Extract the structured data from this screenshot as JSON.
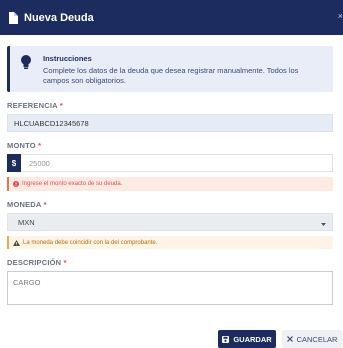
{
  "modal": {
    "title": "Nueva Deuda",
    "close_label": "×"
  },
  "info": {
    "title": "Instrucciones",
    "text": "Complete los datos de la deuda que desea registrar manualmente. Todos los campos son obligatorios."
  },
  "fields": {
    "referencia": {
      "label": "REFERENCIA",
      "required": "*",
      "value": "HLCUABCD12345678"
    },
    "monto": {
      "label": "MONTO",
      "required": "*",
      "currency_symbol": "$",
      "placeholder": "25000",
      "error": "Ingrese el monto exacto de su deuda."
    },
    "moneda": {
      "label": "MONEDA",
      "required": "*",
      "value": "MXN",
      "warning": "La moneda debe coincidir con la del comprobante."
    },
    "descripcion": {
      "label": "DESCRIPCIÓN",
      "required": "*",
      "value": "CARGO"
    }
  },
  "buttons": {
    "save": "GUARDAR",
    "cancel": "CANCELAR"
  },
  "colors": {
    "primary": "#1d2c5e",
    "error": "#d9534f",
    "warning": "#b86d11"
  },
  "icons": [
    "document-icon",
    "close-icon",
    "lightbulb-icon",
    "error-circle-icon",
    "warning-triangle-icon",
    "chevron-down-icon",
    "save-icon",
    "cancel-x-icon"
  ]
}
